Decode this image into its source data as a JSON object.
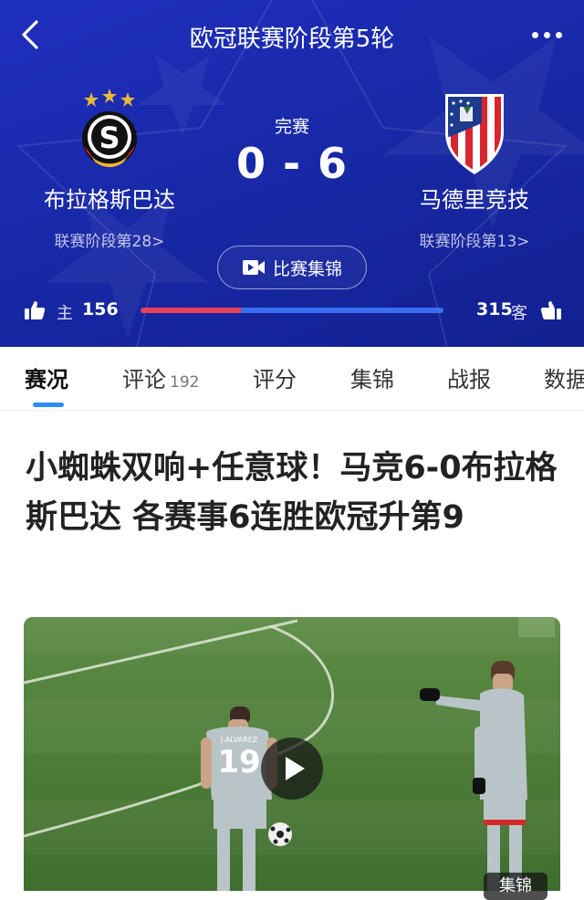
{
  "header": {
    "title": "欧冠联赛阶段第5轮",
    "status": "完赛",
    "home_score": "0",
    "score_sep": "-",
    "away_score": "6",
    "highlights_label": "比赛集锦"
  },
  "home_team": {
    "name": "布拉格斯巴达",
    "rank": "联赛阶段第28>",
    "logo_letter": "S"
  },
  "away_team": {
    "name": "马德里竞技",
    "rank": "联赛阶段第13>"
  },
  "support": {
    "home_label": "主",
    "home_count": 156,
    "away_label": "客",
    "away_count": 315,
    "home_share": 0.331,
    "home_color": "#e8415a",
    "away_color": "#3a6df0"
  },
  "tabs": [
    {
      "label": "赛况",
      "active": true
    },
    {
      "label": "评论",
      "count": "192"
    },
    {
      "label": "评分"
    },
    {
      "label": "集锦"
    },
    {
      "label": "战报"
    },
    {
      "label": "数据"
    }
  ],
  "article": {
    "headline": "小蜘蛛双响+任意球！马竞6-0布拉格斯巴达 各赛事6连胜欧冠升第9",
    "video_badge": "集锦",
    "player_number": "19",
    "player_name": "J.ALVAREZ"
  },
  "icons": {
    "back": "back-arrow-icon",
    "more": "more-icon",
    "video": "video-camera-icon",
    "thumb": "thumbs-up-icon",
    "play": "play-icon"
  },
  "colors": {
    "header_bg": "#1829a8",
    "tab_indicator": "#2a8cf0"
  }
}
